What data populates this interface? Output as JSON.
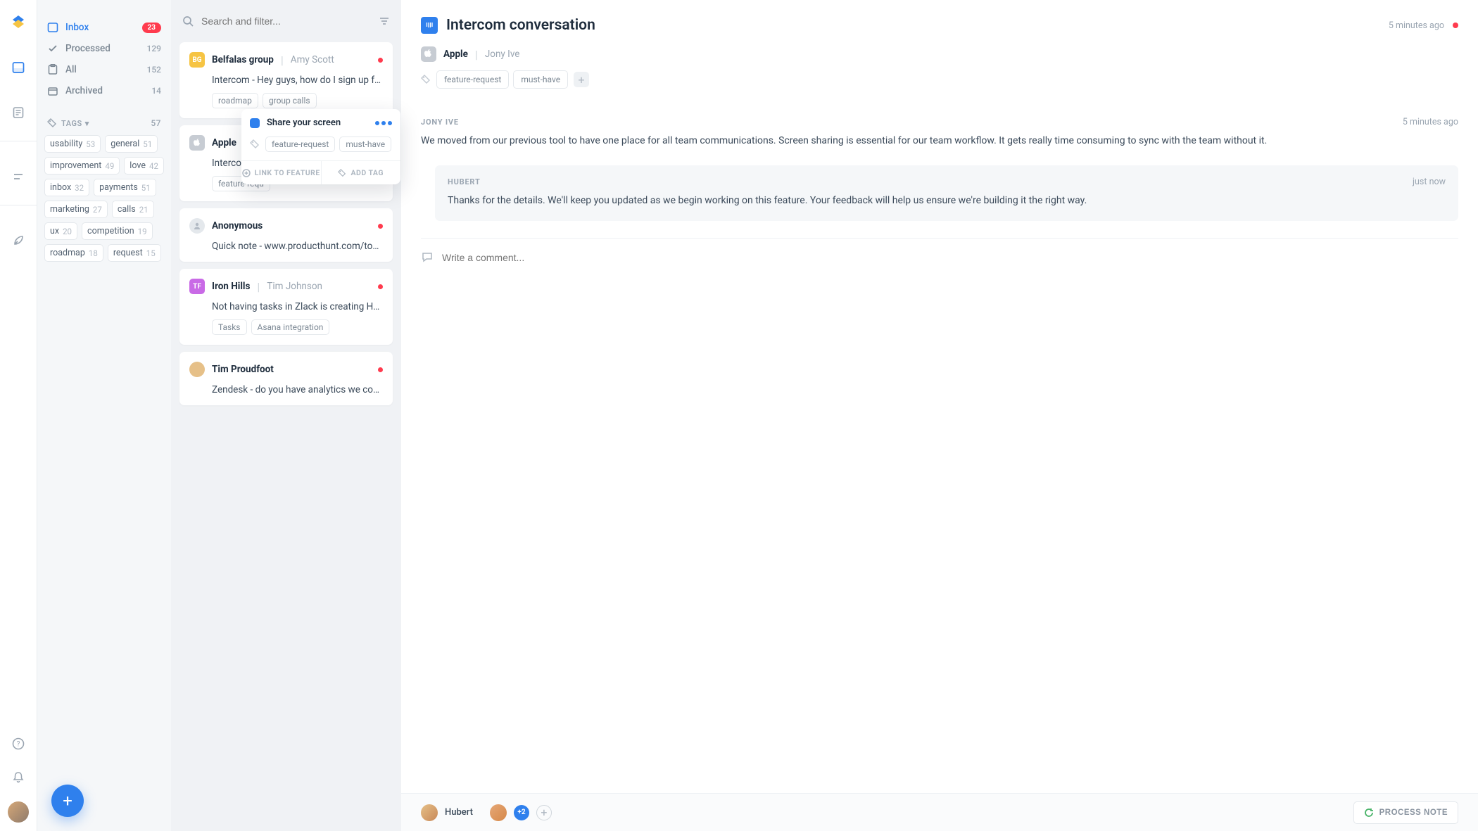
{
  "nav": {
    "items": [
      {
        "label": "Inbox",
        "count": "23",
        "badge": true
      },
      {
        "label": "Processed",
        "count": "129"
      },
      {
        "label": "All",
        "count": "152"
      },
      {
        "label": "Archived",
        "count": "14"
      }
    ],
    "tags_section": {
      "title": "TAGS",
      "count": "57"
    },
    "tags": [
      {
        "label": "usability",
        "count": "53"
      },
      {
        "label": "general",
        "count": "51"
      },
      {
        "label": "improvement",
        "count": "49"
      },
      {
        "label": "love",
        "count": "42"
      },
      {
        "label": "inbox",
        "count": "32"
      },
      {
        "label": "payments",
        "count": "51"
      },
      {
        "label": "marketing",
        "count": "27"
      },
      {
        "label": "calls",
        "count": "21"
      },
      {
        "label": "ux",
        "count": "20"
      },
      {
        "label": "competition",
        "count": "19"
      },
      {
        "label": "roadmap",
        "count": "18"
      },
      {
        "label": "request",
        "count": "15"
      }
    ]
  },
  "search": {
    "placeholder": "Search and filter..."
  },
  "notes": [
    {
      "avatar_bg": "#f6c443",
      "avatar_text": "BG",
      "company": "Belfalas group",
      "person": "Amy Scott",
      "unread": true,
      "body": "Intercom - Hey guys, how do I sign up for your",
      "tags": [
        "roadmap",
        "group calls"
      ]
    },
    {
      "avatar_bg": "#c7ccd3",
      "avatar_text": "",
      "company": "Apple",
      "person": "Jony Ive",
      "unread": false,
      "body": "Intercom - we",
      "tags": [
        "feature-requ"
      ]
    },
    {
      "avatar_bg": "#e4e8ec",
      "avatar_text": "",
      "company": "Anonymous",
      "person": "",
      "unread": true,
      "body": "Quick note - www.producthunt.com/tools",
      "tags": []
    },
    {
      "avatar_bg": "#c96ae6",
      "avatar_text": "TF",
      "company": "Iron Hills",
      "person": "Tim Johnson",
      "unread": true,
      "body": "Not having tasks in Zlack is creating HUGE",
      "tags": [
        "Tasks",
        "Asana integration"
      ]
    },
    {
      "avatar_bg": "#e6c088",
      "avatar_text": "",
      "company": "Tim Proudfoot",
      "person": "",
      "unread": true,
      "body": "Zendesk - do you have analytics we could use to",
      "tags": []
    }
  ],
  "popover": {
    "title": "Share your screen",
    "tags": [
      "feature-request",
      "must-have"
    ],
    "action_link": "LINK TO FEATURE",
    "action_add": "ADD TAG"
  },
  "detail": {
    "title": "Intercom conversation",
    "time": "5 minutes ago",
    "company": "Apple",
    "person": "Jony Ive",
    "tags": [
      "feature-request",
      "must-have"
    ],
    "messages": [
      {
        "author": "JONY IVE",
        "time": "5 minutes ago",
        "body": "We moved from our previous tool to have one place for all team communications. Screen sharing is essential for our team workflow. It gets really time consuming to sync with the team without it."
      },
      {
        "author": "HUBERT",
        "time": "just now",
        "body": "Thanks for the details. We'll keep you updated as we begin working on this feature. Your feedback will help us ensure we're building it the right way."
      }
    ],
    "comment_placeholder": "Write a comment...",
    "footer": {
      "owner": "Hubert",
      "extra": "+2",
      "action": "PROCESS NOTE"
    }
  }
}
